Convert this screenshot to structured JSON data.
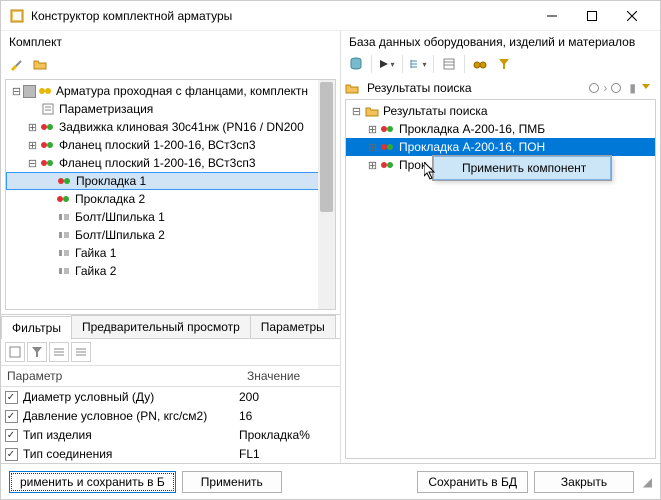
{
  "window": {
    "title": "Конструктор комплектной арматуры"
  },
  "left": {
    "header": "Комплект",
    "tree": [
      {
        "indent": 0,
        "toggle": "−",
        "checkbox": "mixed",
        "label": "Арматура проходная с фланцами, комплектн"
      },
      {
        "indent": 1,
        "toggle": "",
        "icon": "param",
        "label": "Параметризация"
      },
      {
        "indent": 1,
        "toggle": "+",
        "icon": "rg",
        "label": "Задвижка клиновая 30с41нж (PN16 / DN200"
      },
      {
        "indent": 1,
        "toggle": "+",
        "icon": "rg",
        "label": "Фланец плоский 1-200-16, ВСт3сп3"
      },
      {
        "indent": 1,
        "toggle": "−",
        "icon": "rg",
        "label": "Фланец плоский 1-200-16, ВСт3сп3"
      },
      {
        "indent": 2,
        "toggle": "",
        "icon": "rg2",
        "label": "Прокладка 1",
        "selected": true
      },
      {
        "indent": 2,
        "toggle": "",
        "icon": "rg2",
        "label": "Прокладка 2"
      },
      {
        "indent": 2,
        "toggle": "",
        "icon": "b",
        "label": "Болт/Шпилька 1"
      },
      {
        "indent": 2,
        "toggle": "",
        "icon": "b",
        "label": "Болт/Шпилька 2"
      },
      {
        "indent": 2,
        "toggle": "",
        "icon": "b",
        "label": "Гайка 1"
      },
      {
        "indent": 2,
        "toggle": "",
        "icon": "b",
        "label": "Гайка 2"
      }
    ],
    "tabs": [
      "Фильтры",
      "Предварительный просмотр",
      "Параметры"
    ],
    "active_tab": 0,
    "param_header_name": "Параметр",
    "param_header_value": "Значение",
    "params": [
      {
        "checked": true,
        "name": "Диаметр условный (Ду)",
        "value": "200"
      },
      {
        "checked": true,
        "name": "Давление условное (PN, кгс/см2)",
        "value": "16"
      },
      {
        "checked": true,
        "name": "Тип изделия",
        "value": "Прокладка%"
      },
      {
        "checked": true,
        "name": "Тип соединения",
        "value": "FL1"
      }
    ]
  },
  "right": {
    "header": "База данных оборудования, изделий и материалов",
    "search_label": "Результаты поиска",
    "results": [
      {
        "indent": 0,
        "toggle": "−",
        "icon": "folder",
        "label": "Результаты поиска"
      },
      {
        "indent": 1,
        "toggle": "+",
        "icon": "rg",
        "label": "Прокладка А-200-16, ПМБ"
      },
      {
        "indent": 1,
        "toggle": "+",
        "icon": "rg",
        "label": "Прокладка А-200-16, ПОН",
        "hl": true
      },
      {
        "indent": 1,
        "toggle": "+",
        "icon": "rg",
        "label": "Прок..."
      }
    ],
    "context_menu": "Применить компонент"
  },
  "buttons": {
    "apply_save_db": "рименить и сохранить в Б",
    "apply": "Применить",
    "save_db": "Сохранить в БД",
    "close": "Закрыть"
  }
}
